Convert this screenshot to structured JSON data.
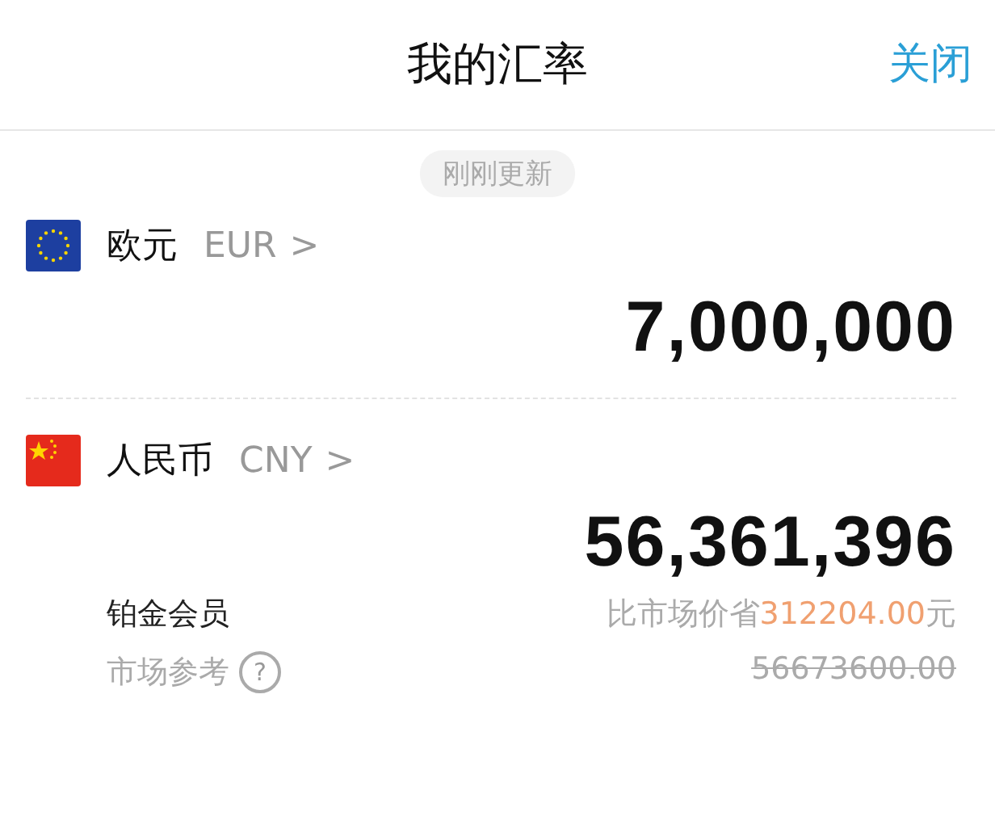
{
  "header": {
    "title": "我的汇率",
    "close": "关闭"
  },
  "update_badge": "刚刚更新",
  "currencies": [
    {
      "kind": "eu",
      "name": "欧元",
      "code": "EUR",
      "chevron": ">",
      "amount": "7,000,000"
    },
    {
      "kind": "cn",
      "name": "人民币",
      "code": "CNY",
      "chevron": ">",
      "amount": "56,361,396"
    }
  ],
  "membership": {
    "tier": "铂金会员",
    "reference": "市场参考",
    "help": "?",
    "savings_prefix": "比市场价省",
    "savings_amount": "312204.00",
    "savings_suffix": "元",
    "market_price": "56673600.00"
  }
}
